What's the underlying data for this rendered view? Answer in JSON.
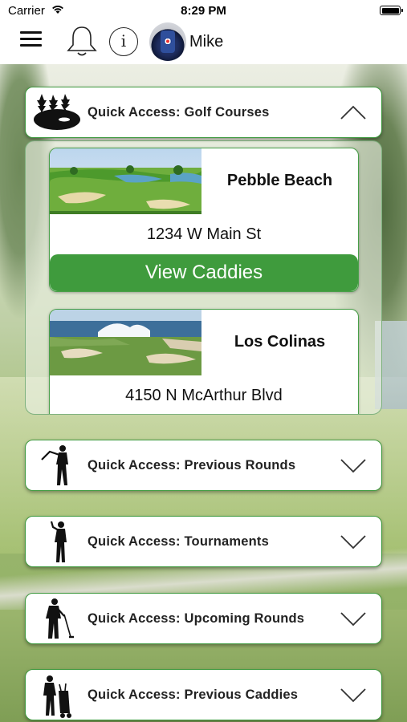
{
  "status_bar": {
    "carrier": "Carrier",
    "time": "8:29 PM"
  },
  "nav": {
    "username": "Mike",
    "info_glyph": "i"
  },
  "courses_section": {
    "label": "Quick Access: Golf Courses",
    "icon": "golf-course-island-icon",
    "expanded": true,
    "courses": [
      {
        "name": "Pebble Beach",
        "address": "1234 W Main St",
        "action": "View Caddies"
      },
      {
        "name": "Los Colinas",
        "address": "4150 N McArthur Blvd"
      }
    ]
  },
  "sections": [
    {
      "label": "Quick Access: Previous Rounds",
      "icon": "golfer-swing-icon"
    },
    {
      "label": "Quick Access: Tournaments",
      "icon": "golfer-silhouette-icon"
    },
    {
      "label": "Quick Access: Upcoming Rounds",
      "icon": "golfer-with-club-icon"
    },
    {
      "label": "Quick Access: Previous Caddies",
      "icon": "caddie-with-bag-icon"
    }
  ],
  "colors": {
    "accent_green": "#3f9b3d",
    "border_green": "#49a049"
  }
}
